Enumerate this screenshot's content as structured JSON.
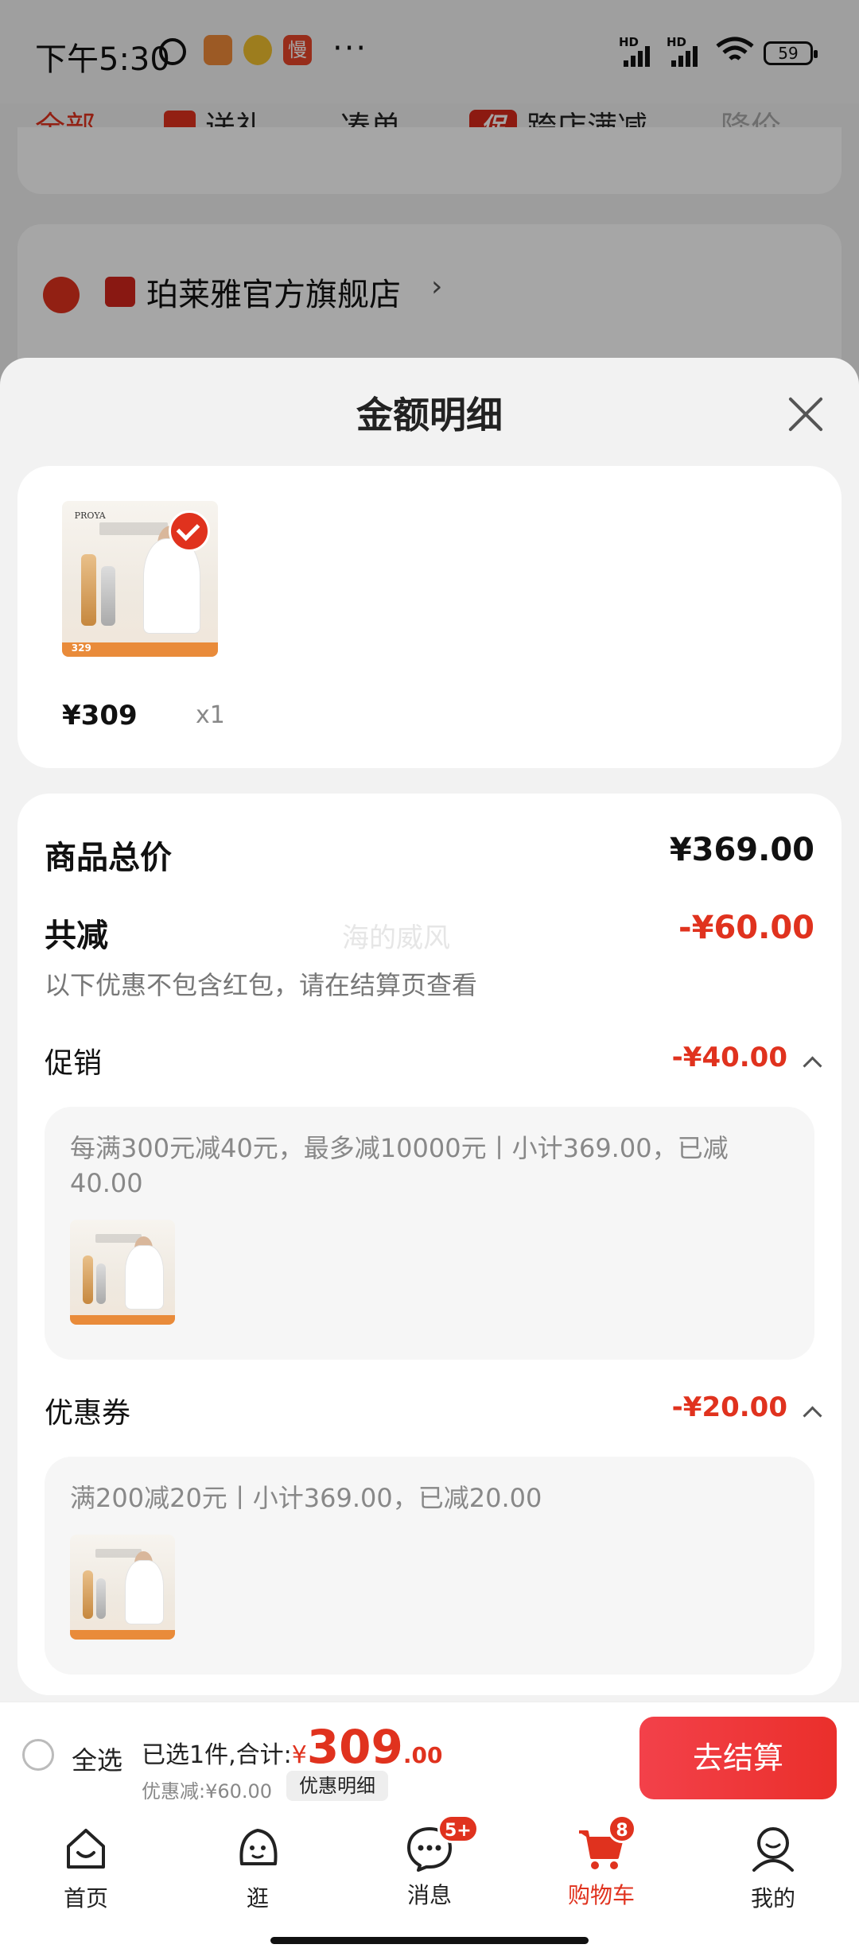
{
  "status_bar": {
    "time": "下午5:30",
    "app_icon_3": "慢",
    "overflow": "···",
    "network_1": "HD",
    "network_2": "HD",
    "battery": "59",
    "icons": [
      "alarm-icon",
      "app-notification-icon",
      "weibo-icon",
      "app-slow-icon",
      "signal-icon",
      "signal-icon",
      "wifi-icon",
      "battery-icon"
    ]
  },
  "filter_tabs": [
    {
      "label": "全部",
      "state": "active"
    },
    {
      "label": "送礼",
      "icon": "gift-icon"
    },
    {
      "label": "凑单"
    },
    {
      "label": "跨店满减",
      "icon_text": "促"
    },
    {
      "label": "降价",
      "state": "muted"
    }
  ],
  "background_store": {
    "name": "珀莱雅官方旗舰店",
    "chevron": "›"
  },
  "sheet": {
    "title": "金额明细",
    "product": {
      "price": "¥309",
      "quantity": "x1",
      "image": {
        "brand": "PROYA",
        "price_chip": "329"
      }
    },
    "summary": {
      "total_label": "商品总价",
      "total_value": "¥369.00",
      "reduced_label": "共减",
      "reduced_value": "-¥60.00",
      "note": "以下优惠不包含红包，请在结算页查看",
      "watermark": "海的威风"
    },
    "promotion": {
      "label": "促销",
      "value": "-¥40.00",
      "detail": "每满300元减40元，最多减10000元丨小计369.00，已减40.00"
    },
    "coupon": {
      "label": "优惠券",
      "value": "-¥20.00",
      "detail": "满200减20元丨小计369.00，已减20.00"
    }
  },
  "checkout": {
    "select_all": "全选",
    "selected_text": "已选1件,合计:",
    "currency": "¥",
    "total_int": "309",
    "total_dec": ".00",
    "saved": "优惠减:¥60.00",
    "detail_button": "优惠明细",
    "pay_button": "去结算"
  },
  "bottom_nav": [
    {
      "label": "首页",
      "icon": "home-icon"
    },
    {
      "label": "逛",
      "icon": "browse-icon"
    },
    {
      "label": "消息",
      "icon": "message-icon",
      "badge": "5+"
    },
    {
      "label": "购物车",
      "icon": "cart-icon",
      "badge": "8",
      "active": true
    },
    {
      "label": "我的",
      "icon": "profile-icon"
    }
  ],
  "colors": {
    "accent": "#e0321e",
    "pay_start": "#f3414a",
    "pay_end": "#ea2f2b"
  }
}
